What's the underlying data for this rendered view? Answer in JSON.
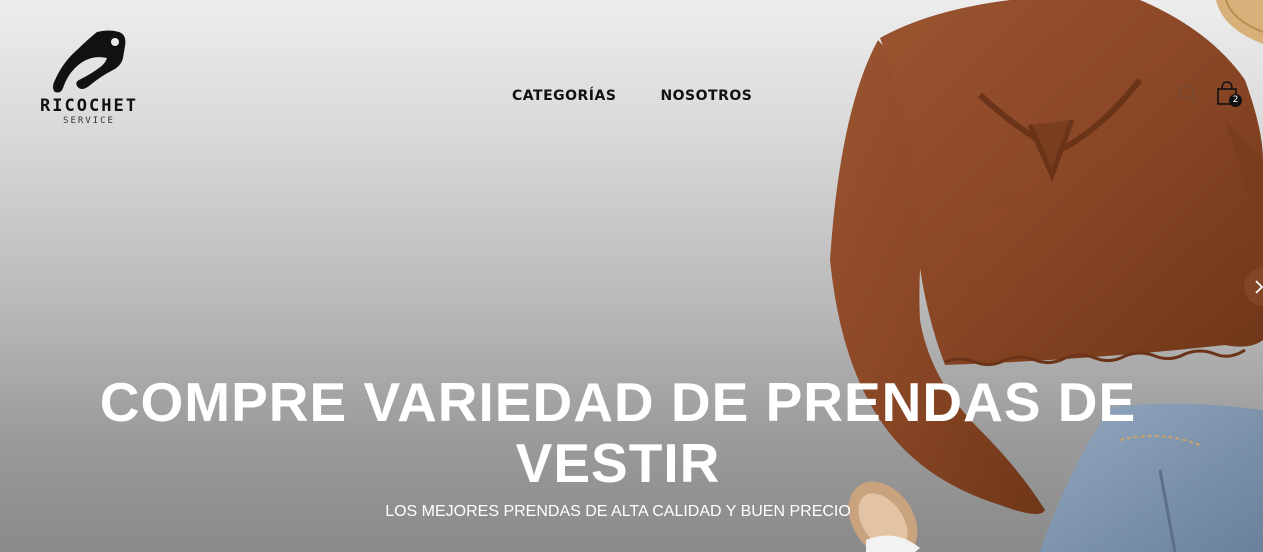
{
  "brand": {
    "name": "RICOCHET",
    "tagline": "SERVICE",
    "logo_icon": "price-tag-icon"
  },
  "nav": {
    "items": [
      {
        "label": "CATEGORÍAS"
      },
      {
        "label": "NOSOTROS"
      }
    ]
  },
  "header_actions": {
    "search_icon": "search-icon",
    "cart_icon": "shopping-bag-icon",
    "cart_count": "2"
  },
  "hero": {
    "title": "COMPRE VARIEDAD DE PRENDAS DE VESTIR",
    "subtitle": "LOS MEJORES PRENDAS DE ALTA CALIDAD Y BUEN PRECIO",
    "next_icon": "chevron-right-icon"
  },
  "colors": {
    "text_dark": "#111111",
    "hero_text": "#ffffff",
    "sweater": "#8b4a28",
    "denim": "#7f95ad"
  }
}
